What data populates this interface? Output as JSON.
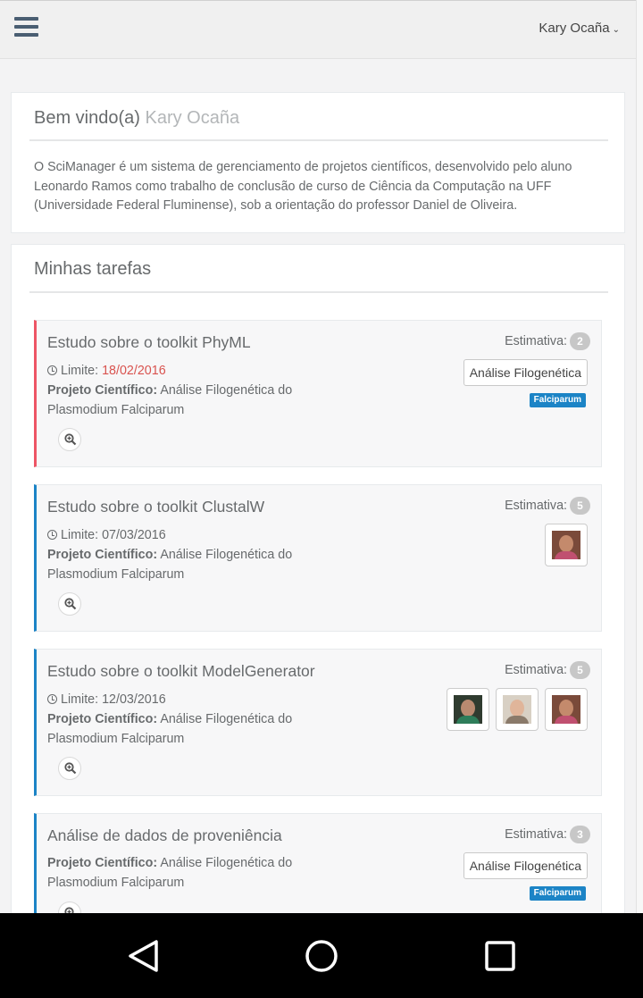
{
  "header": {
    "user_name": "Kary Ocaña",
    "chevron": "chevron-down-icon"
  },
  "welcome": {
    "greeting": "Bem vindo(a)",
    "name": "Kary Ocaña",
    "description": "O SciManager é um sistema de gerenciamento de projetos científicos, desenvolvido pelo aluno Leonardo Ramos como trabalho de conclusão de curso de Ciência da Computação na UFF (Universidade Federal Fluminense), sob a orientação do professor Daniel de Oliveira."
  },
  "tasks_section": {
    "title": "Minhas tarefas",
    "estimate_label": "Estimativa:",
    "deadline_label": "Limite:",
    "project_label": "Projeto Científico:",
    "tasks": [
      {
        "title": "Estudo sobre o toolkit PhyML",
        "deadline": "18/02/2016",
        "deadline_overdue": true,
        "project": "Análise Filogenética do Plasmodium Falciparum",
        "estimate": "2",
        "tag_button": "Análise Filogenética",
        "tag_label": "Falciparum",
        "avatars": []
      },
      {
        "title": "Estudo sobre o toolkit ClustalW",
        "deadline": "07/03/2016",
        "deadline_overdue": false,
        "project": "Análise Filogenética do Plasmodium Falciparum",
        "estimate": "5",
        "avatars": [
          "woman-dark-hair"
        ]
      },
      {
        "title": "Estudo sobre o toolkit ModelGenerator",
        "deadline": "12/03/2016",
        "deadline_overdue": false,
        "project": "Análise Filogenética do Plasmodium Falciparum",
        "estimate": "5",
        "avatars": [
          "man-glasses",
          "woman-blonde",
          "woman-dark-hair"
        ]
      },
      {
        "title": "Análise de dados de proveniência",
        "project": "Análise Filogenética do Plasmodium Falciparum",
        "estimate": "3",
        "tag_button": "Análise Filogenética",
        "tag_label": "Falciparum",
        "avatars": []
      }
    ]
  },
  "colors": {
    "accent_blue": "#1c84c6",
    "overdue_red": "#ed5565",
    "deadline_red": "#d9534f"
  },
  "android_nav": {
    "back": "back-triangle-icon",
    "home": "home-circle-icon",
    "recents": "recents-square-icon"
  }
}
